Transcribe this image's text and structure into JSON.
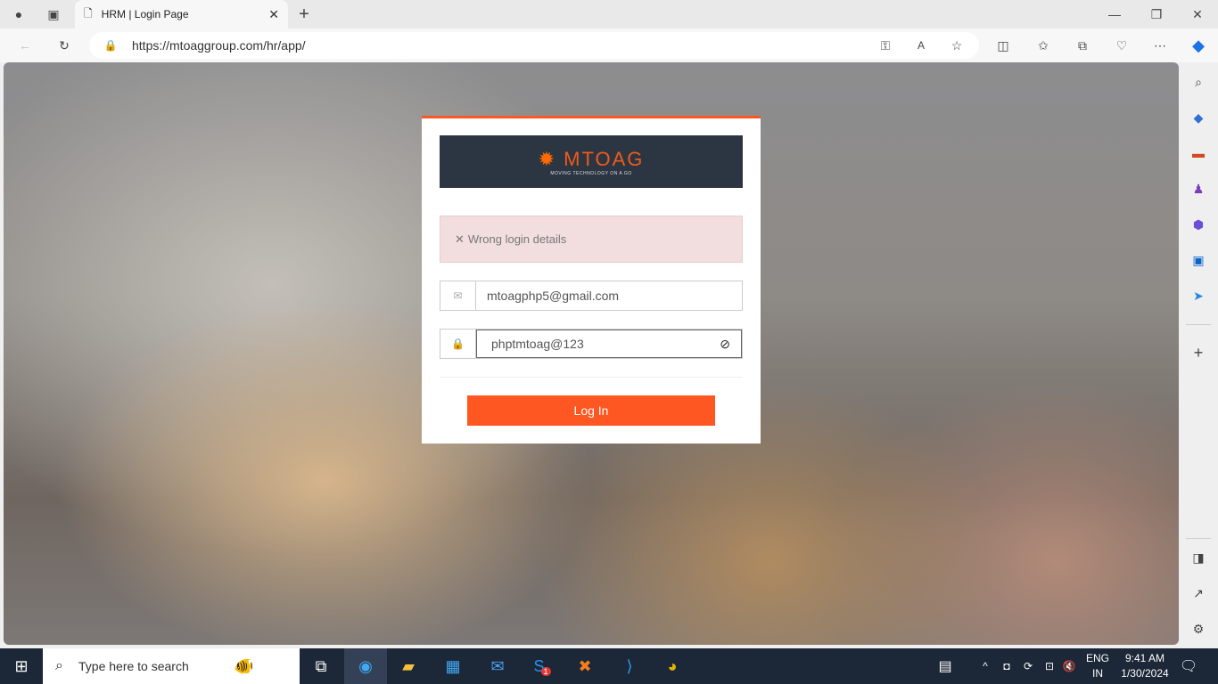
{
  "browser": {
    "tab_title": "HRM | Login Page",
    "url": "https://mtoaggroup.com/hr/app/"
  },
  "login": {
    "logo_text": "MTOAG",
    "logo_tagline": "MOVING TECHNOLOGY ON A GO",
    "error": "Wrong login details",
    "email": "mtoagphp5@gmail.com",
    "password": "phptmtoag@123",
    "login_button": "Log In"
  },
  "taskbar": {
    "search_placeholder": "Type here to search",
    "lang1": "ENG",
    "lang2": "IN",
    "time": "9:41 AM",
    "date": "1/30/2024",
    "skype_badge": "1"
  },
  "colors": {
    "accent": "#ff5722",
    "taskbar": "#1c2737"
  }
}
